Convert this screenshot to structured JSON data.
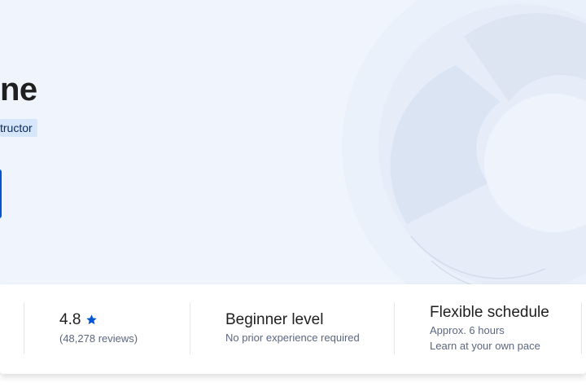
{
  "hero": {
    "title_fragment": "ne",
    "instructor_fragment": "tructor"
  },
  "stats": {
    "rating": {
      "value": "4.8",
      "reviews": "(48,278 reviews)",
      "icon": "star-icon",
      "icon_color": "#0056d2"
    },
    "level": {
      "title": "Beginner level",
      "subtitle": "No prior experience required"
    },
    "schedule": {
      "title": "Flexible schedule",
      "duration": "Approx. 6 hours",
      "pace": "Learn at your own pace"
    }
  },
  "colors": {
    "hero_background": "#f0f5fd",
    "primary": "#0056d2",
    "chip_background": "#d6e6fb"
  }
}
